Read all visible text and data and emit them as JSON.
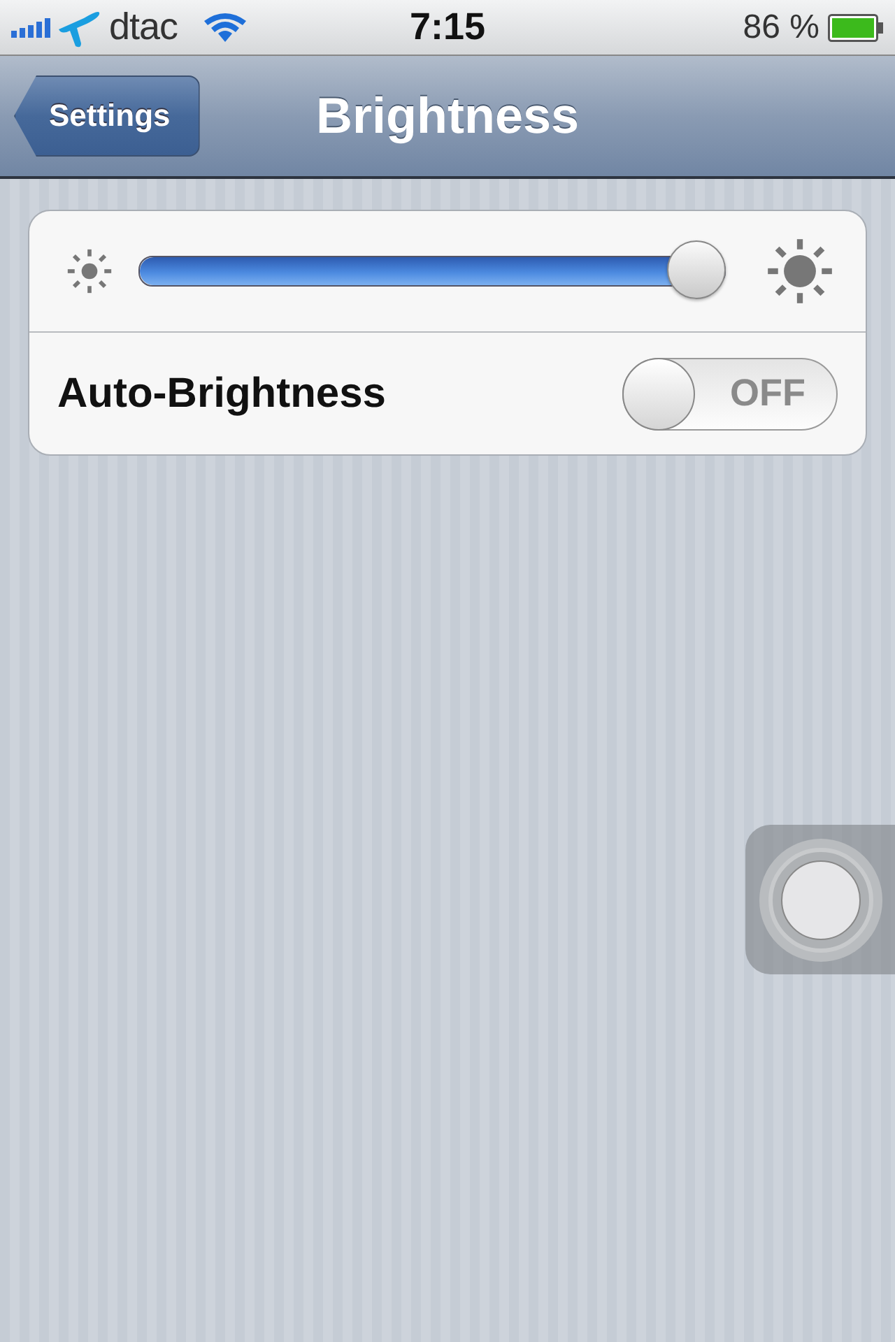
{
  "status_bar": {
    "carrier": "dtac",
    "time": "7:15",
    "battery": "86 %"
  },
  "nav_bar": {
    "back_button": "Settings",
    "title": "Brightness"
  },
  "brightness": {
    "level": 0.95
  },
  "auto_brightness": {
    "label": "Auto-Brightness",
    "on": false,
    "state_text": "OFF"
  }
}
